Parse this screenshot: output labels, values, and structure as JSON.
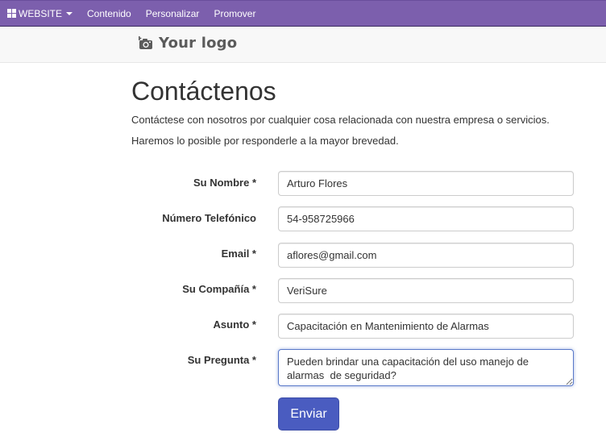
{
  "topbar": {
    "website_label": "WEBSITE",
    "links": [
      "Contenido",
      "Personalizar",
      "Promover"
    ],
    "bg_color": "#7c5fad"
  },
  "header": {
    "logo_text": "Your logo",
    "logo_icon": "camera-icon"
  },
  "page": {
    "title": "Contáctenos",
    "intro_line1": "Contáctese con nosotros por cualquier cosa relacionada con nuestra empresa o servicios.",
    "intro_line2": "Haremos lo posible por responderle a la mayor brevedad."
  },
  "form": {
    "fields": [
      {
        "label": "Su Nombre *",
        "value": "Arturo Flores"
      },
      {
        "label": "Número Telefónico",
        "value": "54-958725966"
      },
      {
        "label": "Email *",
        "value": "aflores@gmail.com"
      },
      {
        "label": "Su Compañía *",
        "value": "VeriSure"
      },
      {
        "label": "Asunto *",
        "value": "Capacitación en Mantenimiento de Alarmas"
      },
      {
        "label": "Su Pregunta *",
        "value": "Pueden brindar una capacitación del uso manejo de alarmas  de seguridad?"
      }
    ],
    "submit_label": "Enviar",
    "accent_color": "#4a5cc0"
  }
}
